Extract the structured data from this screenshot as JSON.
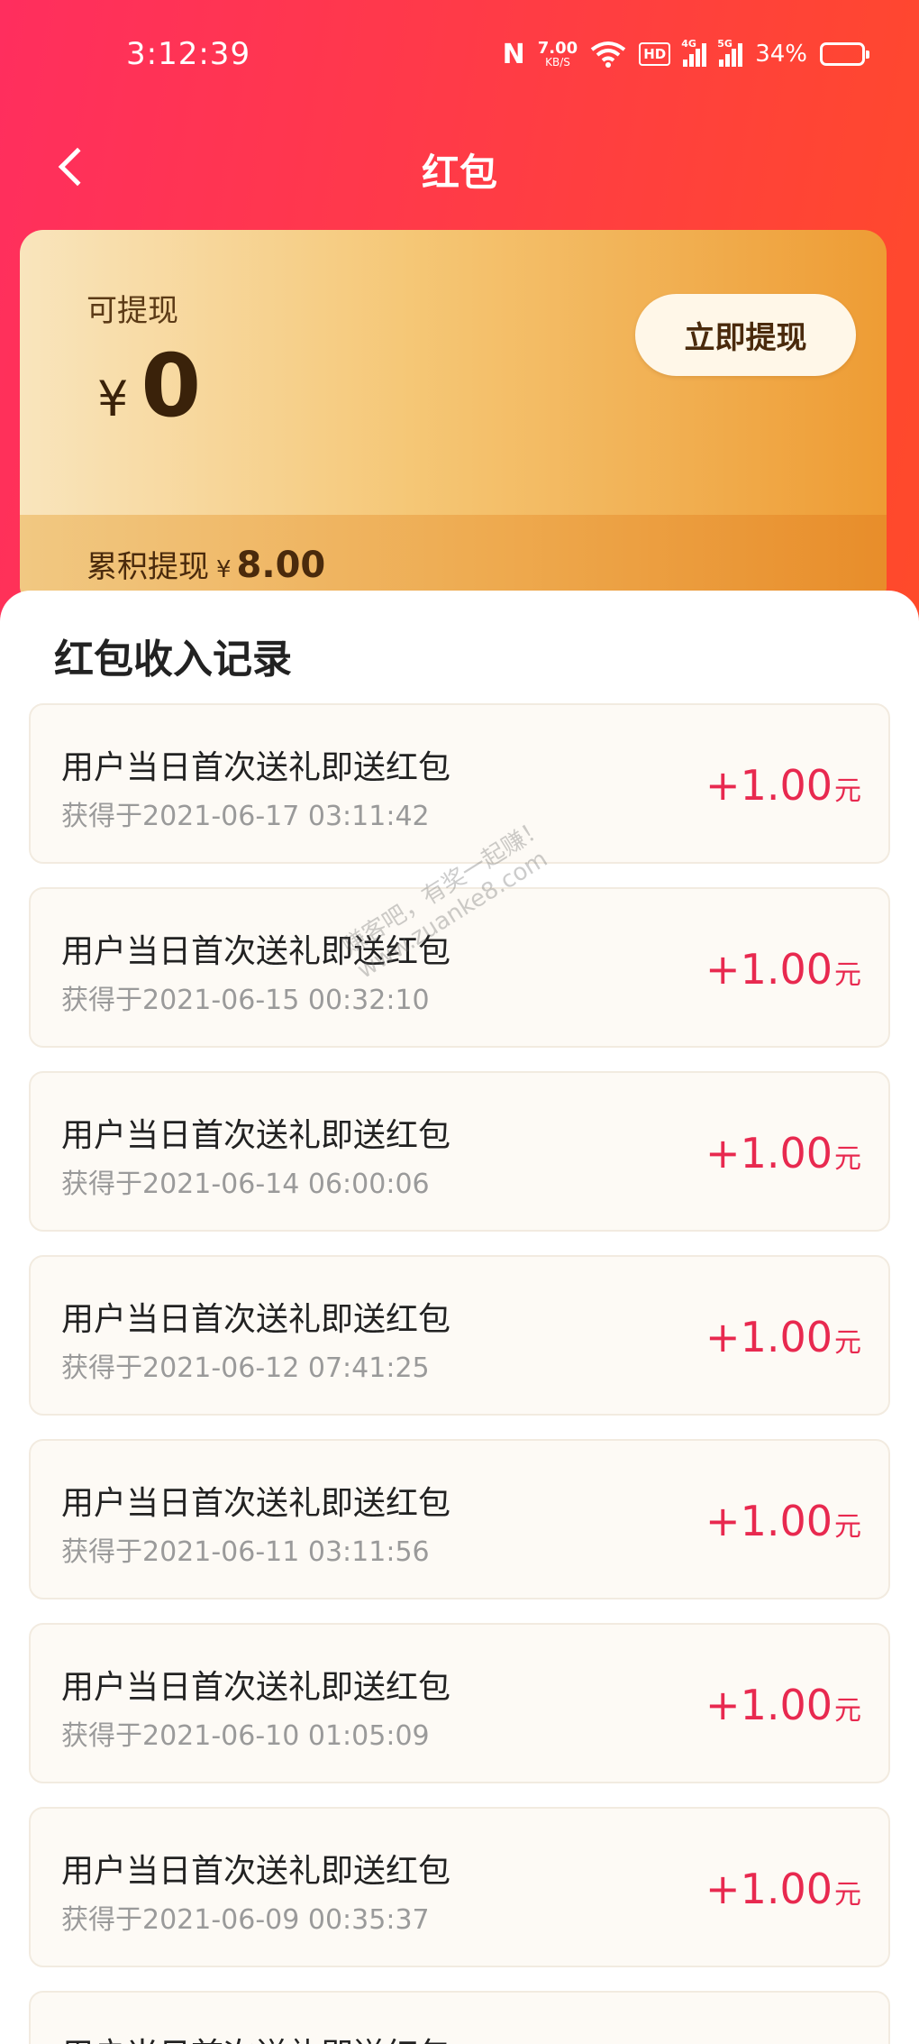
{
  "status_bar": {
    "time": "3:12:39",
    "nfc": "N",
    "speed_value": "7.00",
    "speed_unit": "KB/S",
    "hd": "HD",
    "sig1_label": "4G",
    "sig2_label": "5G",
    "battery_pct": "34%",
    "battery_level": 0.34
  },
  "nav": {
    "title": "红包",
    "back_icon": "chevron-left-icon"
  },
  "balance": {
    "label": "可提现",
    "currency": "¥",
    "amount": "0",
    "withdraw_button": "立即提现",
    "cumulative_label": "累积提现",
    "cumulative_currency": "¥",
    "cumulative_amount": "8.00"
  },
  "records": {
    "title": "红包收入记录",
    "items": [
      {
        "name": "用户当日首次送礼即送红包",
        "time": "获得于2021-06-17 03:11:42",
        "amount": "+1.00",
        "unit": "元"
      },
      {
        "name": "用户当日首次送礼即送红包",
        "time": "获得于2021-06-15 00:32:10",
        "amount": "+1.00",
        "unit": "元"
      },
      {
        "name": "用户当日首次送礼即送红包",
        "time": "获得于2021-06-14 06:00:06",
        "amount": "+1.00",
        "unit": "元"
      },
      {
        "name": "用户当日首次送礼即送红包",
        "time": "获得于2021-06-12 07:41:25",
        "amount": "+1.00",
        "unit": "元"
      },
      {
        "name": "用户当日首次送礼即送红包",
        "time": "获得于2021-06-11 03:11:56",
        "amount": "+1.00",
        "unit": "元"
      },
      {
        "name": "用户当日首次送礼即送红包",
        "time": "获得于2021-06-10 01:05:09",
        "amount": "+1.00",
        "unit": "元"
      },
      {
        "name": "用户当日首次送礼即送红包",
        "time": "获得于2021-06-09 00:35:37",
        "amount": "+1.00",
        "unit": "元"
      },
      {
        "name": "用户当日首次送礼即送红包",
        "time": "",
        "amount": "",
        "unit": ""
      }
    ]
  },
  "watermark": {
    "line1": "赚客吧，有奖一起赚！",
    "line2": "www.zuanke8.com"
  }
}
